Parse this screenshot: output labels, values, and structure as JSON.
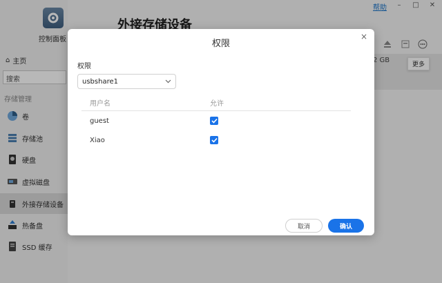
{
  "app": {
    "control_panel_label": "控制面板",
    "page_title": "外接存储设备",
    "help": "帮助",
    "storage_size": "2 GB",
    "more_tooltip": "更多"
  },
  "sidebar": {
    "home": "主页",
    "search_placeholder": "搜索",
    "section": "存储管理",
    "items": [
      {
        "label": "卷",
        "icon": "pie-icon"
      },
      {
        "label": "存储池",
        "icon": "stack-icon"
      },
      {
        "label": "硬盘",
        "icon": "disk-icon"
      },
      {
        "label": "虚拟磁盘",
        "icon": "virtual-disk-icon"
      },
      {
        "label": "外接存储设备",
        "icon": "usb-drive-icon"
      },
      {
        "label": "热备盘",
        "icon": "spare-disk-icon"
      },
      {
        "label": "SSD 缓存",
        "icon": "ssd-icon"
      }
    ],
    "active_index": 4
  },
  "dialog": {
    "title": "权限",
    "field_label": "权限",
    "selected_share": "usbshare1",
    "columns": {
      "user": "用户名",
      "allow": "允许"
    },
    "rows": [
      {
        "user": "guest",
        "allowed": true
      },
      {
        "user": "Xiao",
        "allowed": true
      }
    ],
    "cancel": "取消",
    "ok": "确认"
  },
  "colors": {
    "accent": "#1a73e8"
  }
}
